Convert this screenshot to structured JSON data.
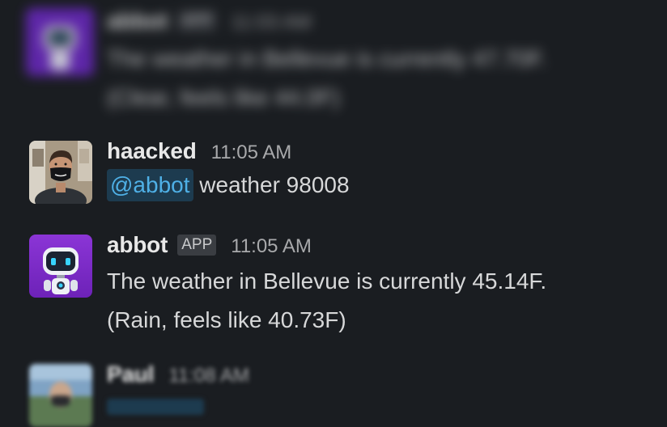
{
  "messages": [
    {
      "author": "abbot",
      "badge": "APP",
      "time": "11:03 AM",
      "text_line1": "The weather in Bellevue is currently 47.70F.",
      "text_line2": "(Clear, feels like 44.0F)"
    },
    {
      "author": "haacked",
      "time": "11:05 AM",
      "mention": "@abbot",
      "text": "weather 98008"
    },
    {
      "author": "abbot",
      "badge": "APP",
      "time": "11:05 AM",
      "text_line1": "The weather in Bellevue is currently 45.14F.",
      "text_line2": "(Rain, feels like 40.73F)"
    },
    {
      "author": "Paul",
      "time": "11:08 AM"
    }
  ],
  "colors": {
    "background": "#1a1d21",
    "mention_bg": "#1d3b4f",
    "mention_text": "#4fb0e6",
    "abbot_avatar": "#7a2fc9"
  }
}
